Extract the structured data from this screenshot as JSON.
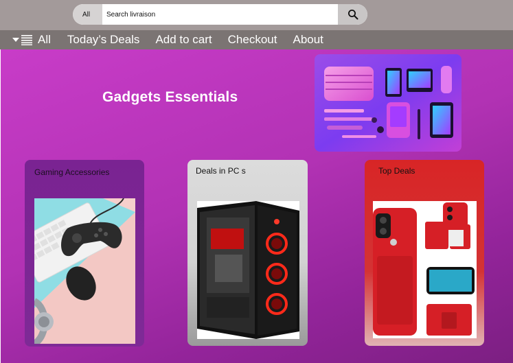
{
  "search": {
    "category": "All",
    "placeholder": "Search livraison",
    "value": ""
  },
  "nav": {
    "items": [
      {
        "label": "All"
      },
      {
        "label": "Today’s Deals"
      },
      {
        "label": "Add to cart"
      },
      {
        "label": "Checkout"
      },
      {
        "label": "About"
      }
    ]
  },
  "hero": {
    "title": "Gadgets Essentials"
  },
  "cards": [
    {
      "title": "Gaming Accessories"
    },
    {
      "title": "Deals in PC s"
    },
    {
      "title": "Top Deals"
    }
  ],
  "colors": {
    "topbar": "#a39a9a",
    "navbar": "#7b7473",
    "main_gradient_start": "#c83cc8",
    "main_gradient_end": "#7c1f82",
    "gaming_card": "#7a2392",
    "pc_card": "#d6d6d6",
    "top_deals_card": "#d82526"
  }
}
